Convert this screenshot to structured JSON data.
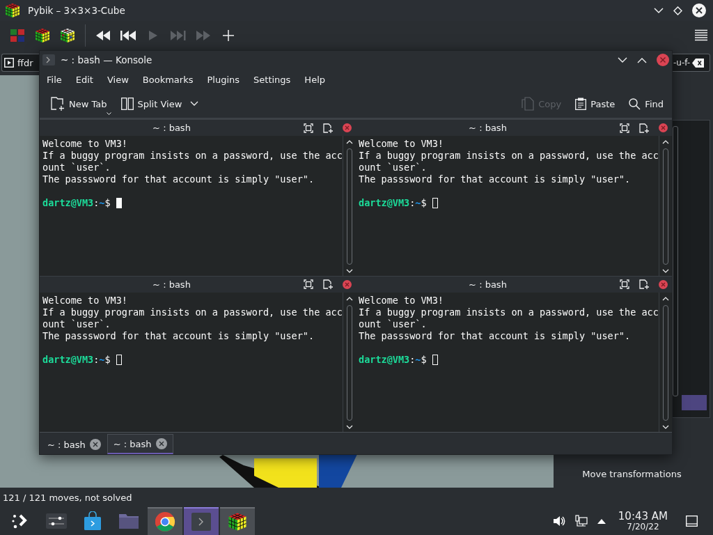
{
  "pybik": {
    "title": "Pybik – 3×3×3-Cube",
    "toolbar": [
      {
        "kind": "color-squares",
        "disabled": false
      },
      {
        "kind": "cube",
        "disabled": false
      },
      {
        "kind": "scrambled-cube",
        "disabled": false
      },
      {
        "kind": "rewind",
        "disabled": false
      },
      {
        "kind": "previous",
        "disabled": false
      },
      {
        "kind": "play",
        "disabled": true
      },
      {
        "kind": "next",
        "disabled": true
      },
      {
        "kind": "forward",
        "disabled": true
      },
      {
        "kind": "add",
        "disabled": false
      }
    ],
    "move_field": {
      "visible_start": "ffdr",
      "visible_end": "-u-f-"
    },
    "side_panel": {
      "label": "Move transformations"
    },
    "status": "121 / 121 moves, not solved"
  },
  "konsole": {
    "title": "~ : bash — Konsole",
    "menu": [
      "File",
      "Edit",
      "View",
      "Bookmarks",
      "Plugins",
      "Settings",
      "Help"
    ],
    "toolbar": [
      {
        "kind": "new-tab",
        "label": "New Tab",
        "disabled": false
      },
      {
        "kind": "split-view",
        "label": "Split View",
        "disabled": false
      },
      {
        "kind": "copy",
        "label": "Copy",
        "disabled": true
      },
      {
        "kind": "paste",
        "label": "Paste",
        "disabled": false
      },
      {
        "kind": "find",
        "label": "Find",
        "disabled": false
      }
    ],
    "panes": [
      {
        "title": "~ : bash",
        "focused": true,
        "lines": [
          "Welcome to VM3!",
          "If a buggy program insists on a password, use the acc",
          "ount `user`.",
          "The passsword for that account is simply \"user\"."
        ],
        "prompt": {
          "user_host": "dartz@VM3",
          "separator": ":",
          "path": "~",
          "sign": "$"
        }
      },
      {
        "title": "~ : bash",
        "focused": false,
        "lines": [
          "Welcome to VM3!",
          "If a buggy program insists on a password, use the acc",
          "ount `user`.",
          "The passsword for that account is simply \"user\"."
        ],
        "prompt": {
          "user_host": "dartz@VM3",
          "separator": ":",
          "path": "~",
          "sign": "$"
        }
      },
      {
        "title": "~ : bash",
        "focused": false,
        "lines": [
          "Welcome to VM3!",
          "If a buggy program insists on a password, use the acc",
          "ount `user`.",
          "The passsword for that account is simply \"user\"."
        ],
        "prompt": {
          "user_host": "dartz@VM3",
          "separator": ":",
          "path": "~",
          "sign": "$"
        }
      },
      {
        "title": "~ : bash",
        "focused": false,
        "lines": [
          "Welcome to VM3!",
          "If a buggy program insists on a password, use the acc",
          "ount `user`.",
          "The passsword for that account is simply \"user\"."
        ],
        "prompt": {
          "user_host": "dartz@VM3",
          "separator": ":",
          "path": "~",
          "sign": "$"
        }
      }
    ],
    "tabs": [
      {
        "label": "~ : bash",
        "selected": false
      },
      {
        "label": "~ : bash",
        "selected": true
      }
    ]
  },
  "taskbar": {
    "items": [
      {
        "kind": "launcher",
        "open": false,
        "selected": false
      },
      {
        "kind": "settings",
        "open": false,
        "selected": false
      },
      {
        "kind": "store",
        "open": false,
        "selected": false
      },
      {
        "kind": "files",
        "open": false,
        "selected": false
      },
      {
        "kind": "browser",
        "open": true,
        "selected": false
      },
      {
        "kind": "terminal",
        "open": true,
        "selected": true
      },
      {
        "kind": "cube",
        "open": true,
        "selected": false
      }
    ],
    "clock": {
      "time": "10:43 AM",
      "date": "7/20/22"
    }
  }
}
